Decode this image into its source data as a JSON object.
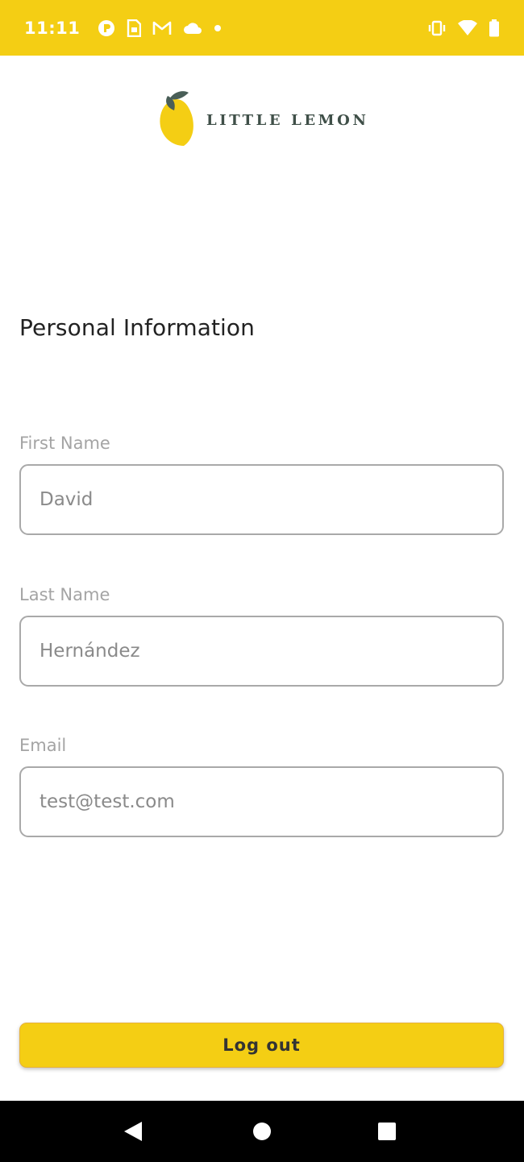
{
  "status_bar": {
    "time": "11:11",
    "icons_left": [
      "app-notification-icon",
      "sim-card-icon",
      "gmail-icon",
      "cloud-icon",
      "dot-icon"
    ],
    "icons_right": [
      "vibrate-icon",
      "wifi-icon",
      "battery-icon"
    ],
    "background": "#F4CE14"
  },
  "header": {
    "logo_text": "LITTLE LEMON",
    "brand_yellow": "#F4CE14",
    "brand_green": "#495E57"
  },
  "profile": {
    "section_title": "Personal Information",
    "fields": [
      {
        "label": "First Name",
        "value": "David"
      },
      {
        "label": "Last Name",
        "value": "Hernández"
      },
      {
        "label": "Email",
        "value": "test@test.com"
      }
    ]
  },
  "actions": {
    "logout_label": "Log out"
  },
  "nav_bar": {
    "buttons": [
      "back-icon",
      "home-icon",
      "recents-icon"
    ]
  }
}
